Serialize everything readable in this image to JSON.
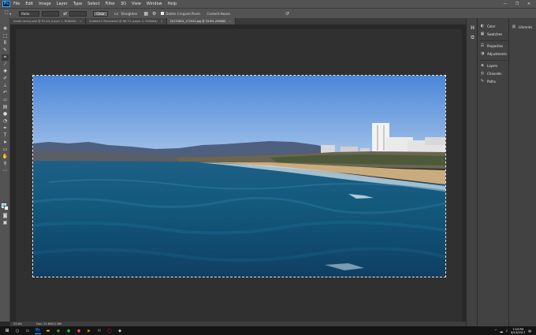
{
  "app": {
    "logo": "Ps",
    "menu": [
      "File",
      "Edit",
      "Image",
      "Layer",
      "Type",
      "Select",
      "Filter",
      "3D",
      "View",
      "Window",
      "Help"
    ],
    "window_controls": [
      "—",
      "❐",
      "✕"
    ]
  },
  "options_bar": {
    "ratio_value": "Ratio",
    "clear_label": "Clear",
    "straighten_label": "Straighten",
    "delete_cropped_label": "Delete Cropped Pixels",
    "content_aware_label": "Content-Aware"
  },
  "tabs": [
    {
      "label": "Inside-racing.psd @ 97.4% (Layer 1, RGB/8#)",
      "close": "×"
    },
    {
      "label": "Untitled-1 Recovered @ 66.7% (Layer 2, RGB/8#)",
      "close": "×"
    },
    {
      "label": "20170815_172533.jpg @ 33.6% (RGB/8)",
      "close": "×"
    }
  ],
  "status": {
    "zoom": "33.6%",
    "doc_info": "Doc: 22.8M/22.8M"
  },
  "panels": {
    "group1": [
      "Color",
      "Swatches"
    ],
    "group2": [
      "Properties",
      "Adjustments"
    ],
    "group3": [
      "Layers",
      "Channels",
      "Paths"
    ],
    "libraries": "Libraries"
  },
  "taskbar": {
    "time": "7:03 PM",
    "date": "8/15/2017"
  },
  "colors": {
    "foreground": "#5ed1c7",
    "background": "#ffffff"
  }
}
